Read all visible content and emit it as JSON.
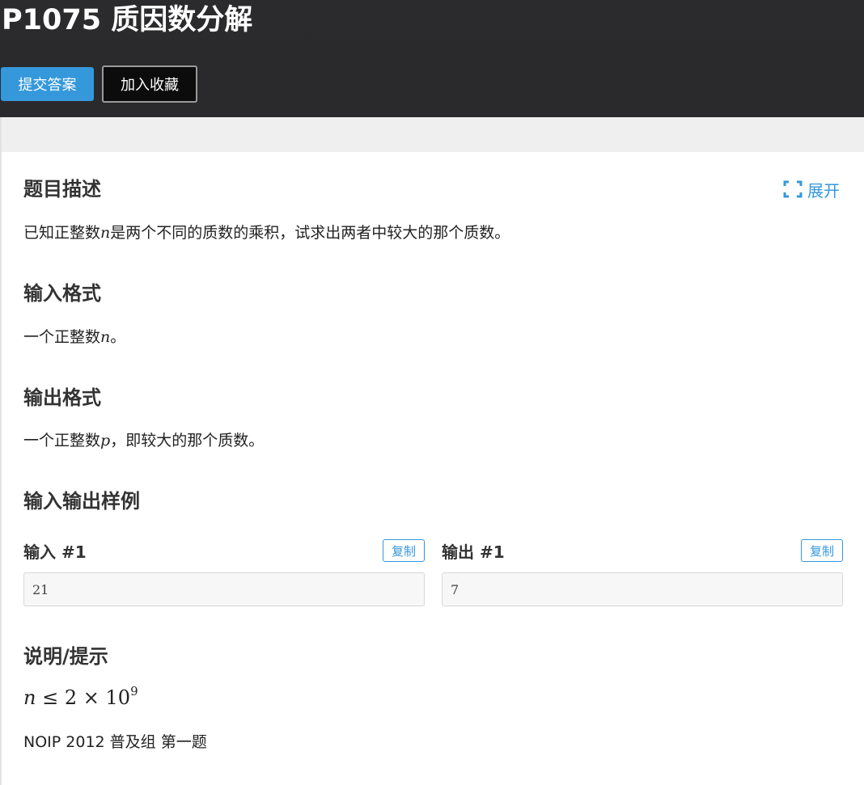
{
  "header": {
    "title": "P1075 质因数分解",
    "submit_label": "提交答案",
    "favorite_label": "加入收藏"
  },
  "description": {
    "title": "题目描述",
    "expand_label": "展开",
    "text_before": "已知正整数",
    "var": "n",
    "text_after": "是两个不同的质数的乘积，试求出两者中较大的那个质数。"
  },
  "input_format": {
    "title": "输入格式",
    "text_before": "一个正整数",
    "var": "n",
    "text_after": "。"
  },
  "output_format": {
    "title": "输出格式",
    "text_before": "一个正整数",
    "var": "p",
    "text_after": "，即较大的那个质数。"
  },
  "samples": {
    "title": "输入输出样例",
    "input_label": "输入 #1",
    "output_label": "输出 #1",
    "copy_label": "复制",
    "input_value": "21",
    "output_value": "7"
  },
  "hint": {
    "title": "说明/提示",
    "formula": {
      "var": "n",
      "leq": "≤",
      "coef": "2",
      "times": "×",
      "base": "10",
      "exponent": "9"
    },
    "source": "NOIP 2012 普及组 第一题"
  }
}
